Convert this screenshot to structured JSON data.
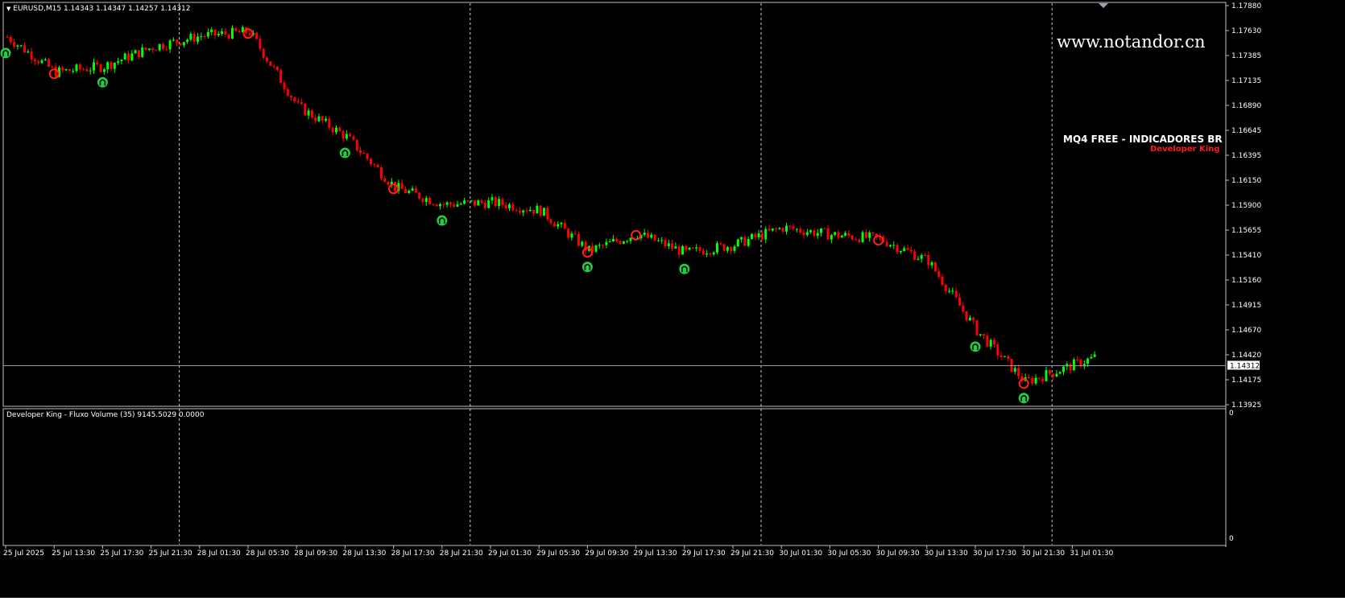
{
  "main_chart": {
    "label_arrow": "▼",
    "symbol_info": "EURUSD,M15  1.14343 1.14347 1.14257 1.14312",
    "watermark": "www.notandor.cn",
    "overlay_title": "MQ4 FREE - INDICADORES BR",
    "overlay_subtitle": "Developer King",
    "current_price_label": "1.14312",
    "price_axis_labels": [
      "1.17880",
      "1.17630",
      "1.17385",
      "1.17135",
      "1.16890",
      "1.16645",
      "1.16395",
      "1.16150",
      "1.15900",
      "1.15655",
      "1.15410",
      "1.15160",
      "1.14915",
      "1.14670",
      "1.14420",
      "1.14175",
      "1.13925"
    ],
    "y_top": 1.1788,
    "y_bottom": 1.13925,
    "current_price": 1.14312
  },
  "subwindow": {
    "indicator_label": "Developer King - Fluxo Volume  (35) 9145.5029 0.0000",
    "axis_top": "0",
    "axis_bottom": "0"
  },
  "time_axis_labels": [
    "25 Jul 2025",
    "25 Jul 13:30",
    "25 Jul 17:30",
    "25 Jul 21:30",
    "28 Jul 01:30",
    "28 Jul 05:30",
    "28 Jul 09:30",
    "28 Jul 13:30",
    "28 Jul 17:30",
    "28 Jul 21:30",
    "29 Jul 01:30",
    "29 Jul 05:30",
    "29 Jul 09:30",
    "29 Jul 13:30",
    "29 Jul 17:30",
    "29 Jul 21:30",
    "30 Jul 01:30",
    "30 Jul 05:30",
    "30 Jul 09:30",
    "30 Jul 13:30",
    "30 Jul 17:30",
    "30 Jul 21:30",
    "31 Jul 01:30"
  ],
  "chart_data": {
    "type": "line",
    "symbol": "EURUSD",
    "timeframe": "M15",
    "x": [
      "25 Jul 2025",
      "25 Jul 13:30",
      "25 Jul 17:30",
      "25 Jul 21:30",
      "28 Jul 01:30",
      "28 Jul 05:30",
      "28 Jul 09:30",
      "28 Jul 13:30",
      "28 Jul 17:30",
      "28 Jul 21:30",
      "29 Jul 01:30",
      "29 Jul 05:30",
      "29 Jul 09:30",
      "29 Jul 13:30",
      "29 Jul 17:30",
      "29 Jul 21:30",
      "30 Jul 01:30",
      "30 Jul 05:30",
      "30 Jul 09:30",
      "30 Jul 13:30",
      "30 Jul 17:30",
      "30 Jul 21:30",
      "31 Jul 01:30"
    ],
    "series": [
      {
        "values": [
          1.1757,
          1.1722,
          1.1728,
          1.1747,
          1.1758,
          1.1762,
          1.1688,
          1.1658,
          1.1608,
          1.1591,
          1.1593,
          1.1585,
          1.1545,
          1.1562,
          1.1543,
          1.1551,
          1.1568,
          1.1561,
          1.1557,
          1.1535,
          1.1466,
          1.1415,
          1.1432
        ]
      }
    ],
    "ylim": [
      1.13925,
      1.1788
    ],
    "grid": false,
    "vertical_separators": [
      "25 Jul 21:30",
      "28 Jul 21:30",
      "29 Jul 21:30",
      "30 Jul 21:30"
    ],
    "horizontal_line": 1.14312,
    "buy_arrows": [
      "25 Jul 2025",
      "25 Jul 17:30",
      "28 Jul 13:30",
      "28 Jul 21:30",
      "29 Jul 09:30",
      "29 Jul 17:30",
      "30 Jul 17:30",
      "30 Jul 21:30"
    ],
    "sell_circles": [
      "25 Jul 13:30",
      "28 Jul 05:30",
      "28 Jul 17:30",
      "29 Jul 09:30",
      "29 Jul 13:30",
      "30 Jul 09:30",
      "30 Jul 21:30"
    ],
    "colors": {
      "bull": "#00ff00",
      "bear": "#ff0000",
      "background": "#000000",
      "arrow": "#22cc44",
      "circle": "#ff2020",
      "price_line": "#8899aa"
    }
  }
}
